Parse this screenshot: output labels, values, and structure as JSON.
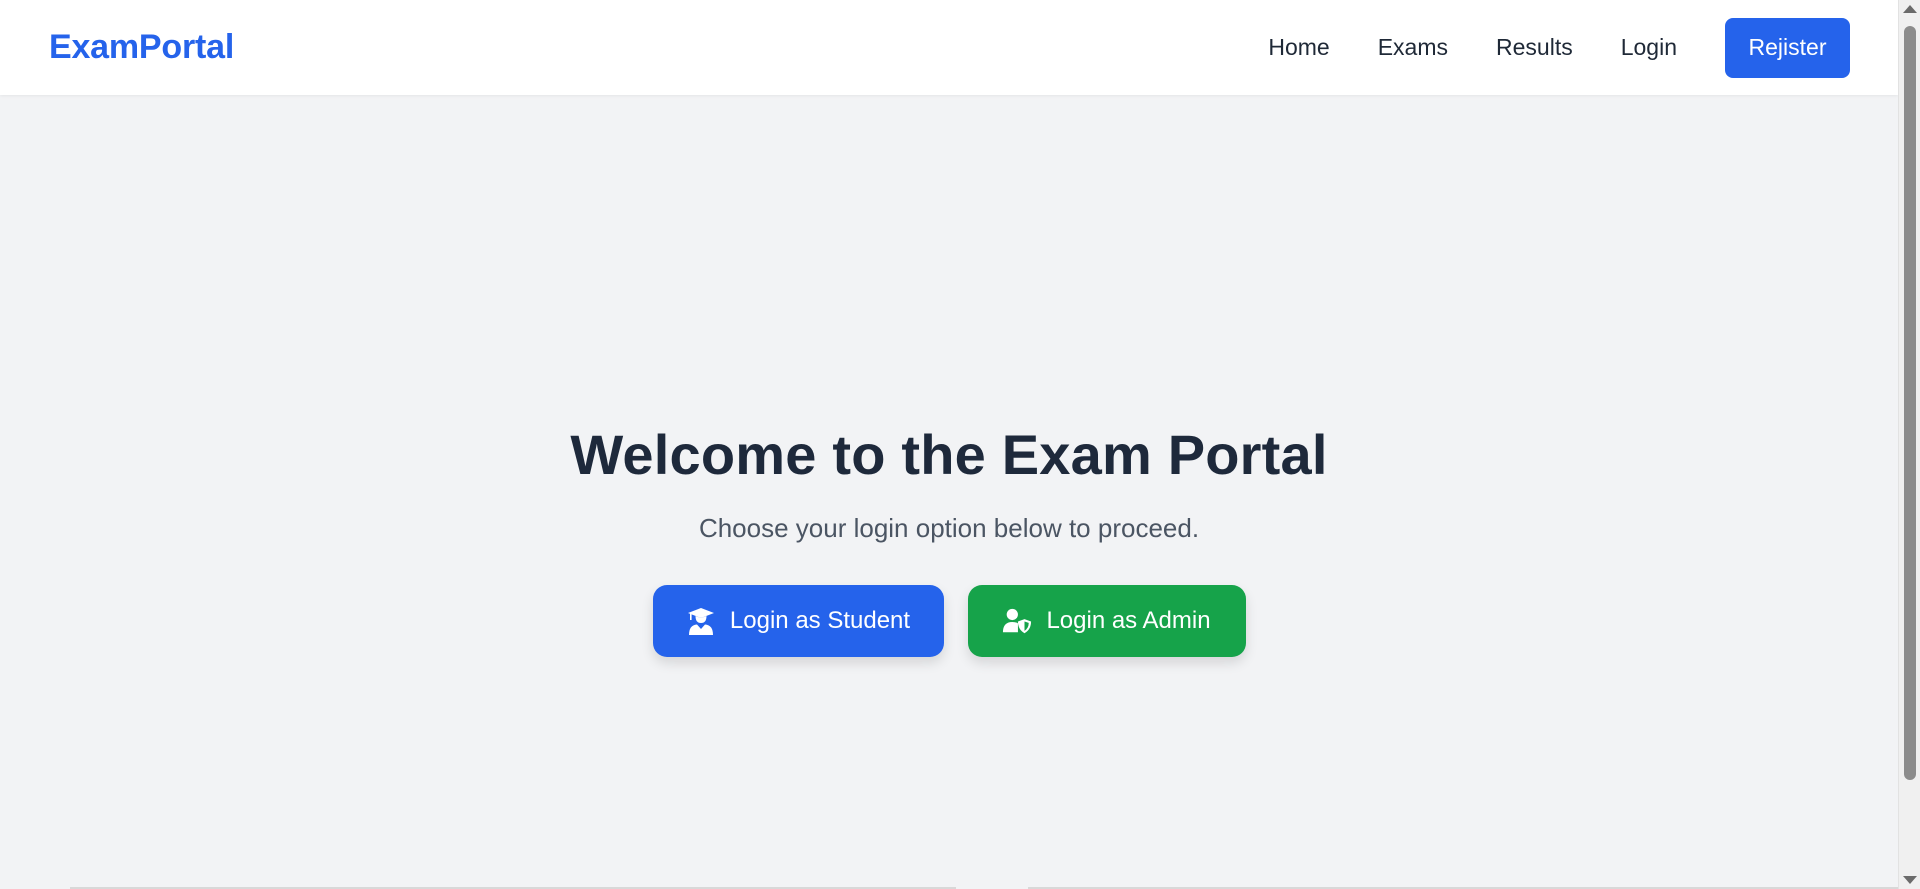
{
  "header": {
    "brand": "ExamPortal",
    "nav": {
      "home": "Home",
      "exams": "Exams",
      "results": "Results",
      "login": "Login",
      "register": "Rejister"
    }
  },
  "hero": {
    "title": "Welcome to the Exam Portal",
    "subtitle": "Choose your login option below to proceed.",
    "student_button": "Login as Student",
    "admin_button": "Login as Admin",
    "student_icon": "student-graduate-icon",
    "admin_icon": "user-shield-icon"
  },
  "colors": {
    "brand": "#2563eb",
    "student_button": "#2563eb",
    "admin_button": "#16a34a",
    "background": "#f2f3f5"
  }
}
